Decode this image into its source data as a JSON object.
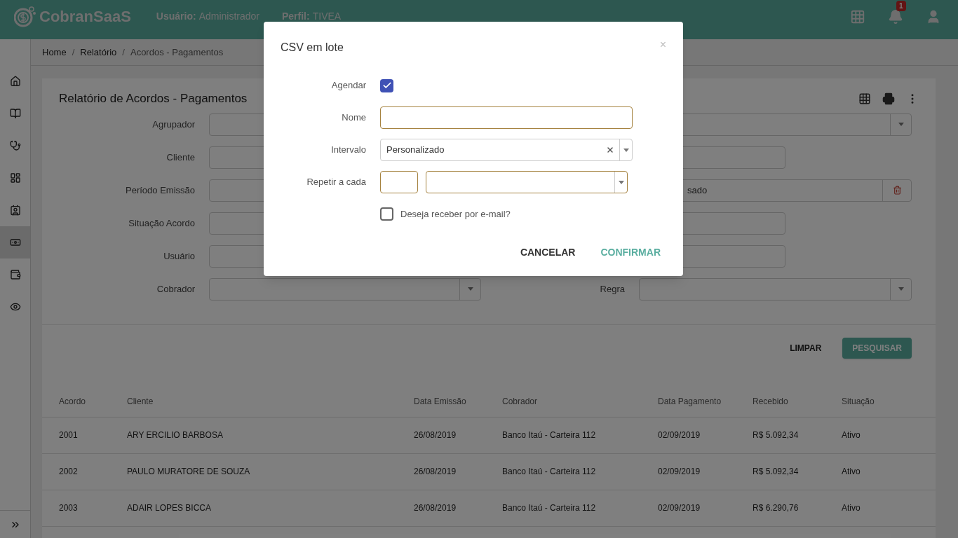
{
  "header": {
    "logo": "CobranSaaS",
    "user_label": "Usuário:",
    "user": "Administrador",
    "profile_label": "Perfil:",
    "profile": "TIVEA",
    "notification_count": "1"
  },
  "sidebar": {
    "items": [
      {
        "selected": false
      },
      {
        "selected": false
      },
      {
        "selected": false
      },
      {
        "selected": false
      },
      {
        "selected": false
      },
      {
        "selected": true
      },
      {
        "selected": false
      },
      {
        "selected": false
      }
    ]
  },
  "breadcrumb": {
    "separator": "/",
    "items": [
      "Home",
      "Relatório",
      "Acordos - Pagamentos"
    ]
  },
  "card": {
    "title": "Relatório de Acordos - Pagamentos",
    "filters_left": [
      {
        "label": "Agrupador",
        "kind": "input"
      },
      {
        "label": "Cliente",
        "kind": "input"
      },
      {
        "label": "Período Emissão",
        "kind": "input"
      },
      {
        "label": "Situação Acordo",
        "kind": "input"
      },
      {
        "label": "Usuário",
        "kind": "input"
      },
      {
        "label": "Cobrador",
        "kind": "select"
      }
    ],
    "filters_right": [
      {
        "kind": "select"
      },
      {
        "kind": "input"
      },
      {
        "kind": "clearable",
        "value": "sado"
      },
      {
        "kind": "input"
      },
      {
        "kind": "input"
      },
      {
        "label": "Regra",
        "kind": "select"
      }
    ],
    "buttons": [
      {
        "label": "LIMPAR",
        "kind": "flat"
      },
      {
        "label": "PESQUISAR",
        "kind": "raised"
      }
    ]
  },
  "table": {
    "columns": [
      "Acordo",
      "Cliente",
      "Data Emissão",
      "Cobrador",
      "Data Pagamento",
      "Recebido",
      "Situação"
    ],
    "rows": [
      [
        "2001",
        "ARY ERCILIO BARBOSA",
        "26/08/2019",
        "Banco Itaú - Carteira 112",
        "02/09/2019",
        "R$ 5.092,34",
        "Ativo"
      ],
      [
        "2002",
        "PAULO MURATORE DE SOUZA",
        "26/08/2019",
        "Banco Itaú - Carteira 112",
        "02/09/2019",
        "R$ 5.092,34",
        "Ativo"
      ],
      [
        "2003",
        "ADAIR LOPES BICCA",
        "26/08/2019",
        "Banco Itaú - Carteira 112",
        "02/09/2019",
        "R$ 6.290,76",
        "Ativo"
      ]
    ]
  },
  "dialog": {
    "title": "CSV em lote",
    "close": "×",
    "fields": [
      {
        "kind": "checkbox",
        "label": "Agendar",
        "checked": true
      },
      {
        "kind": "text",
        "label": "Nome"
      },
      {
        "kind": "select",
        "label": "Intervalo",
        "value": "Personalizado"
      },
      {
        "kind": "repeat",
        "label": "Repetir a cada"
      },
      {
        "kind": "option",
        "label": "Deseja receber por e-mail?",
        "checked": false
      }
    ],
    "actions": [
      {
        "label": "CANCELAR",
        "kind": "secondary"
      },
      {
        "label": "CONFIRMAR",
        "kind": "primary"
      }
    ]
  }
}
